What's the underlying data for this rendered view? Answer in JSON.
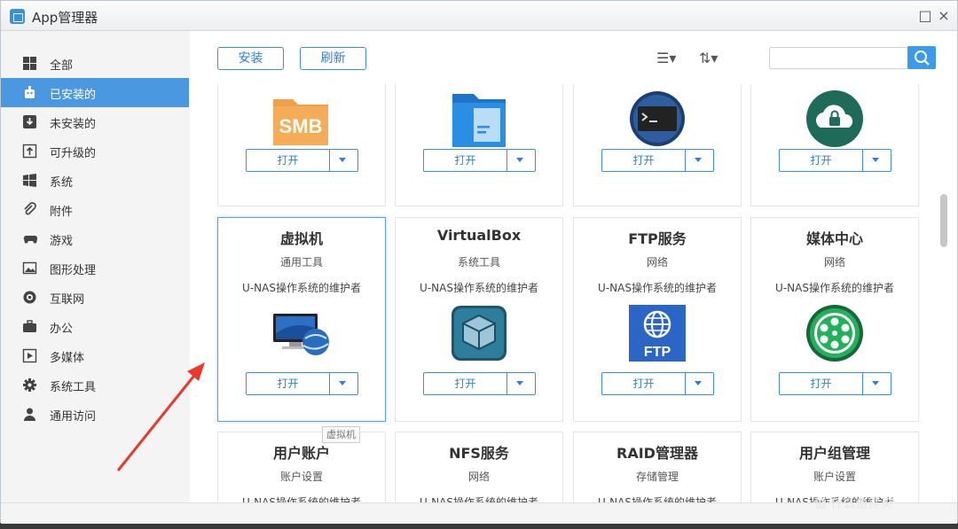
{
  "window": {
    "title": "App管理器"
  },
  "sidebar": {
    "items": [
      {
        "label": "全部",
        "icon": "grid-icon"
      },
      {
        "label": "已安装的",
        "icon": "robot-icon",
        "active": true
      },
      {
        "label": "未安装的",
        "icon": "download-box-icon"
      },
      {
        "label": "可升级的",
        "icon": "upgrade-box-icon"
      },
      {
        "label": "系统",
        "icon": "windows-icon"
      },
      {
        "label": "附件",
        "icon": "paperclip-icon"
      },
      {
        "label": "游戏",
        "icon": "gamepad-icon"
      },
      {
        "label": "图形处理",
        "icon": "image-icon"
      },
      {
        "label": "互联网",
        "icon": "globe-icon"
      },
      {
        "label": "办公",
        "icon": "briefcase-icon"
      },
      {
        "label": "多媒体",
        "icon": "play-icon"
      },
      {
        "label": "系统工具",
        "icon": "gear-icon"
      },
      {
        "label": "通用访问",
        "icon": "user-icon"
      }
    ]
  },
  "toolbar": {
    "install_label": "安装",
    "refresh_label": "刷新",
    "list_view_icon": "list-view-icon",
    "sort_icon": "sort-icon",
    "search_placeholder": "",
    "search_icon": "search-icon"
  },
  "cards": [
    {
      "name": "",
      "category": "",
      "description": "",
      "icon": "smb-folder-icon",
      "open_label": "打开"
    },
    {
      "name": "",
      "category": "",
      "description": "",
      "icon": "file-folder-icon",
      "open_label": "打开"
    },
    {
      "name": "",
      "category": "",
      "description": "",
      "icon": "terminal-icon",
      "open_label": "打开"
    },
    {
      "name": "",
      "category": "",
      "description": "",
      "icon": "cloud-lock-icon",
      "open_label": "打开"
    },
    {
      "name": "虚拟机",
      "category": "通用工具",
      "description": "U-NAS操作系统的维护者",
      "icon": "virtual-machine-icon",
      "open_label": "打开",
      "selected": true
    },
    {
      "name": "VirtualBox",
      "category": "系统工具",
      "description": "U-NAS操作系统的维护者",
      "icon": "virtualbox-icon",
      "open_label": "打开"
    },
    {
      "name": "FTP服务",
      "category": "网络",
      "description": "U-NAS操作系统的维护者",
      "icon": "ftp-icon",
      "open_label": "打开"
    },
    {
      "name": "媒体中心",
      "category": "网络",
      "description": "U-NAS操作系统的维护者",
      "icon": "media-center-icon",
      "open_label": "打开"
    },
    {
      "name": "用户账户",
      "category": "账户设置",
      "description": "U-NAS操作系统的维护者",
      "icon": "",
      "open_label": ""
    },
    {
      "name": "NFS服务",
      "category": "网络",
      "description": "U-NAS操作系统的维护者",
      "icon": "",
      "open_label": ""
    },
    {
      "name": "RAID管理器",
      "category": "存储管理",
      "description": "U-NAS操作系统的维护者",
      "icon": "",
      "open_label": ""
    },
    {
      "name": "用户组管理",
      "category": "账户设置",
      "description": "U-NAS操作系统的维护者",
      "icon": "",
      "open_label": ""
    }
  ],
  "tooltip": "虚拟机",
  "smb_text": "SMB",
  "ftp_text": "FTP",
  "watermark": "值 什么值得买",
  "colors": {
    "accent": "#4a98e0",
    "button_border": "#3b8ee0",
    "arrow": "#e8392c"
  }
}
